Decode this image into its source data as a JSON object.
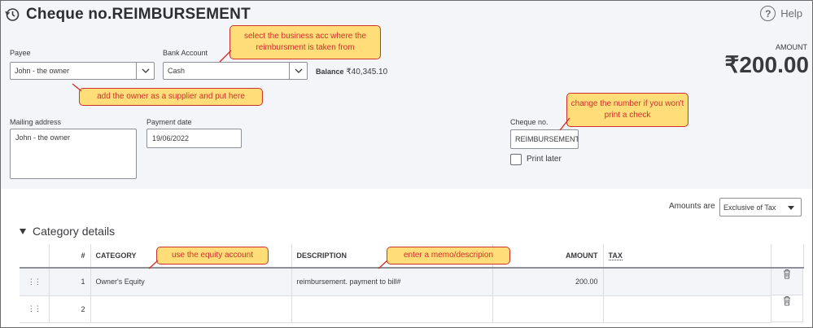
{
  "header": {
    "title": "Cheque no.REIMBURSEMENT",
    "help_label": "Help",
    "help_glyph": "?"
  },
  "payee": {
    "label": "Payee",
    "value": "John - the owner"
  },
  "bank_account": {
    "label": "Bank Account",
    "value": "Cash"
  },
  "balance": {
    "label": "Balance",
    "value": "₹40,345.10"
  },
  "amount": {
    "label": "AMOUNT",
    "value": "₹200.00"
  },
  "mailing_address": {
    "label": "Mailing address",
    "value": "John - the owner"
  },
  "payment_date": {
    "label": "Payment date",
    "value": "19/06/2022"
  },
  "cheque_no": {
    "label": "Cheque no.",
    "value": "REIMBURSEMENT"
  },
  "print_later": {
    "label": "Print later",
    "checked": false
  },
  "amounts_are": {
    "label": "Amounts are",
    "value": "Exclusive of Tax"
  },
  "category_details": {
    "title": "Category details",
    "columns": [
      "",
      "#",
      "CATEGORY",
      "DESCRIPTION",
      "AMOUNT",
      "TAX",
      ""
    ],
    "rows": [
      {
        "num": "1",
        "category": "Owner's Equity",
        "description": "reimbursement. payment to bill#",
        "amount": "200.00",
        "tax": ""
      },
      {
        "num": "2",
        "category": "",
        "description": "",
        "amount": "",
        "tax": ""
      }
    ]
  },
  "callouts": {
    "bank": "select the business acc where the reimbursment is taken from",
    "payee": "add the owner as a supplier and put here",
    "cheque": "change the number if you won't print a check",
    "category": "use the equity account",
    "description": "enter a memo/descripion"
  },
  "icons": [
    "history-icon",
    "help-icon",
    "chevron-down-icon",
    "drag-handle-icon",
    "trash-icon"
  ],
  "colors": {
    "callout_fill": "#ffde7a",
    "callout_border": "#d0312d",
    "header_bg": "#f4f5f8"
  }
}
